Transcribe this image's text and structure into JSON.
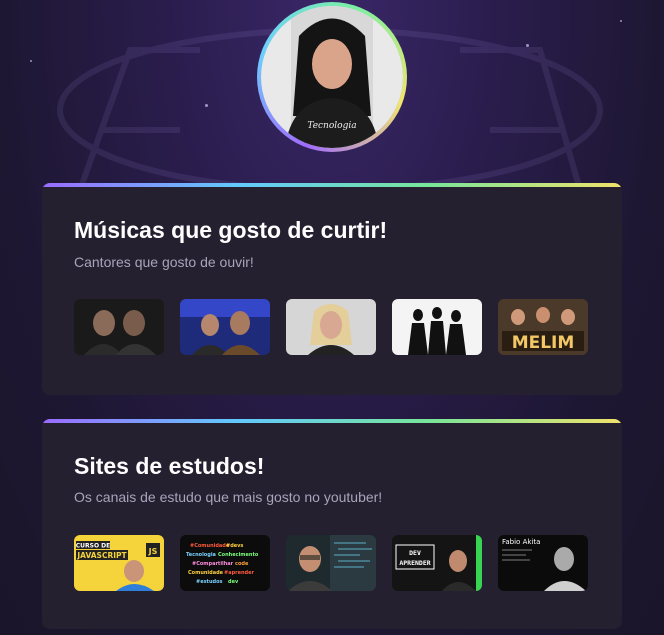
{
  "background": {
    "accent_gradient": [
      "#9b6bff",
      "#62c8ff",
      "#78e59a",
      "#f0e26b"
    ],
    "card_bg": "#24202f"
  },
  "profile": {
    "avatar_alt": "Foto de perfil"
  },
  "sections": [
    {
      "title": "Músicas que gosto de curtir!",
      "subtitle": "Cantores que gosto de ouvir!",
      "items": [
        {
          "name": "singer-duo-1"
        },
        {
          "name": "singer-duo-2"
        },
        {
          "name": "singer-female"
        },
        {
          "name": "singer-group"
        },
        {
          "name": "melim",
          "label": "MELIM"
        }
      ]
    },
    {
      "title": "Sites de estudos!",
      "subtitle": "Os canais de estudo que mais gosto no youtuber!",
      "items": [
        {
          "name": "curso-javascript",
          "label1": "CURSO DE",
          "label2": "JAVASCRIPT"
        },
        {
          "name": "comunidade-conhecimento"
        },
        {
          "name": "dev-channel"
        },
        {
          "name": "dev-aprender",
          "label1": "DEV",
          "label2": "APRENDER"
        },
        {
          "name": "fabio-akita",
          "label": "Fabio Akita"
        }
      ]
    }
  ]
}
